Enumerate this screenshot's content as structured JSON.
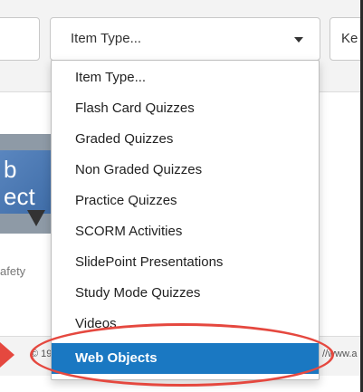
{
  "filter": {
    "selected_value": "Item Type...",
    "next_button_label": "Ke"
  },
  "dropdown": {
    "options": [
      {
        "label": "Item Type..."
      },
      {
        "label": "Flash Card Quizzes"
      },
      {
        "label": "Graded Quizzes"
      },
      {
        "label": "Non Graded Quizzes"
      },
      {
        "label": "Practice Quizzes"
      },
      {
        "label": "SCORM Activities"
      },
      {
        "label": "SlidePoint Presentations"
      },
      {
        "label": "Study Mode Quizzes"
      },
      {
        "label": "Videos"
      },
      {
        "label": "Web Objects"
      }
    ],
    "selected_index": 9
  },
  "background": {
    "thumbnail_text": "b\nect",
    "side_caption": "afety",
    "footer_left": "© 199",
    "footer_right": "//www.a"
  },
  "colors": {
    "selected_bg": "#1a78c2",
    "annotation_red": "#e5483f"
  }
}
